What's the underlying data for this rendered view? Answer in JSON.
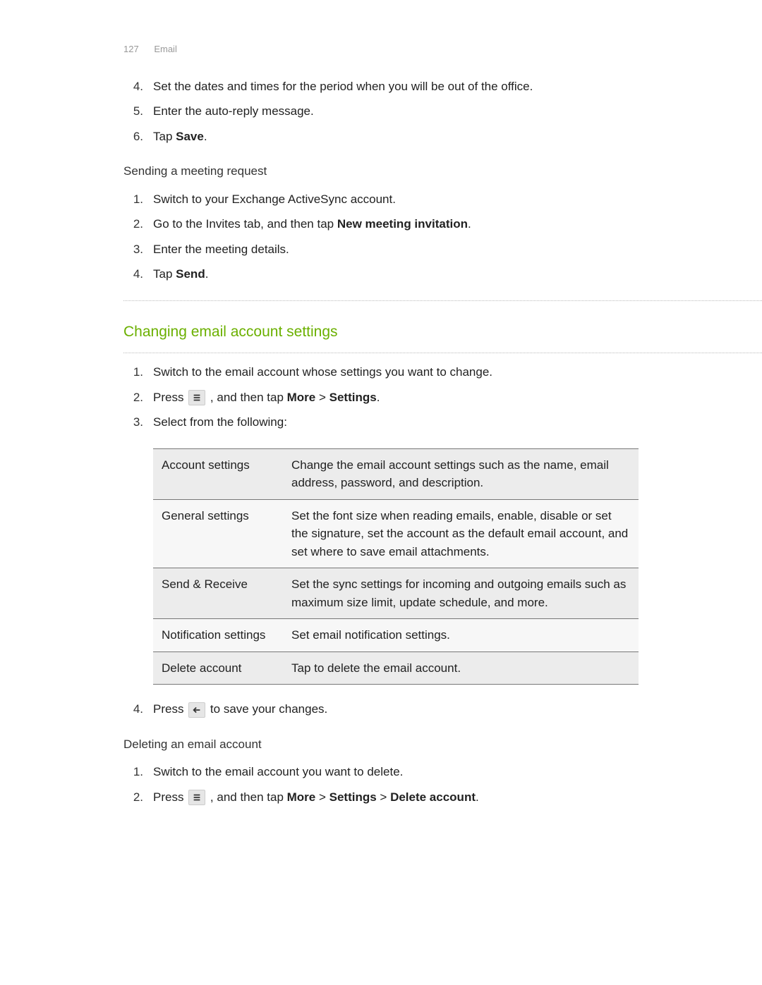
{
  "header": {
    "page_number": "127",
    "section": "Email"
  },
  "top_steps": [
    {
      "n": "4.",
      "text": "Set the dates and times for the period when you will be out of the office."
    },
    {
      "n": "5.",
      "text": "Enter the auto-reply message."
    },
    {
      "n": "6.",
      "pre": "Tap ",
      "bold": "Save",
      "post": "."
    }
  ],
  "sending": {
    "title": "Sending a meeting request",
    "steps": [
      {
        "n": "1.",
        "text": "Switch to your Exchange ActiveSync account."
      },
      {
        "n": "2.",
        "pre": "Go to the Invites tab, and then tap ",
        "bold": "New meeting invitation",
        "post": "."
      },
      {
        "n": "3.",
        "text": "Enter the meeting details."
      },
      {
        "n": "4.",
        "pre": "Tap ",
        "bold": "Send",
        "post": "."
      }
    ]
  },
  "changing": {
    "title": "Changing email account settings",
    "steps_a": [
      {
        "n": "1.",
        "text": "Switch to the email account whose settings you want to change."
      }
    ],
    "step2": {
      "n": "2.",
      "pre": "Press ",
      "mid": " , and then tap ",
      "b1": "More",
      "sep": " > ",
      "b2": "Settings",
      "post": "."
    },
    "step3": {
      "n": "3.",
      "text": "Select from the following:"
    },
    "table": [
      {
        "name": "Account settings",
        "desc": "Change the email account settings such as the name, email address, password, and description."
      },
      {
        "name": "General settings",
        "desc": "Set the font size when reading emails, enable, disable or set the signature, set the account as the default email account, and set where to save email attachments."
      },
      {
        "name": "Send & Receive",
        "desc": "Set the sync settings for incoming and outgoing emails such as maximum size limit, update schedule, and more."
      },
      {
        "name": "Notification settings",
        "desc": "Set email notification settings."
      },
      {
        "name": "Delete account",
        "desc": "Tap to delete the email account."
      }
    ],
    "step4": {
      "n": "4.",
      "pre": "Press ",
      "post": " to save your changes."
    }
  },
  "deleting": {
    "title": "Deleting an email account",
    "step1": {
      "n": "1.",
      "text": "Switch to the email account you want to delete."
    },
    "step2": {
      "n": "2.",
      "pre": "Press ",
      "mid": " , and then tap ",
      "b1": "More",
      "s1": " > ",
      "b2": "Settings",
      "s2": " > ",
      "b3": "Delete account",
      "post": "."
    }
  }
}
